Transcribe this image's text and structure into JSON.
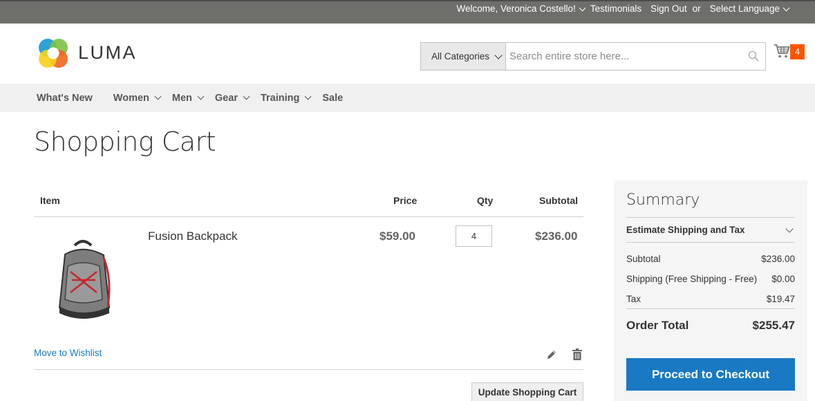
{
  "topbar": {
    "welcome": "Welcome, Veronica Costello!",
    "testimonials": "Testimonials",
    "sign_out": "Sign Out",
    "or": "or",
    "language": "Select Language"
  },
  "header": {
    "logo_text": "LUMA",
    "category_select": "All Categories",
    "search_placeholder": "Search entire store here...",
    "cart_count": "4"
  },
  "nav": {
    "items": [
      {
        "label": "What's New"
      },
      {
        "label": "Women"
      },
      {
        "label": "Men"
      },
      {
        "label": "Gear"
      },
      {
        "label": "Training"
      },
      {
        "label": "Sale"
      }
    ]
  },
  "page": {
    "title": "Shopping Cart"
  },
  "cart": {
    "headers": {
      "item": "Item",
      "price": "Price",
      "qty": "Qty",
      "subtotal": "Subtotal"
    },
    "items": [
      {
        "name": "Fusion Backpack",
        "price": "$59.00",
        "qty": "4",
        "subtotal": "$236.00"
      }
    ],
    "move_to_wishlist": "Move to Wishlist",
    "update_button": "Update Shopping Cart"
  },
  "summary": {
    "title": "Summary",
    "estimate": "Estimate Shipping and Tax",
    "rows": [
      {
        "label": "Subtotal",
        "value": "$236.00"
      },
      {
        "label": "Shipping (Free Shipping - Free)",
        "value": "$0.00"
      },
      {
        "label": "Tax",
        "value": "$19.47"
      }
    ],
    "order_total_label": "Order Total",
    "order_total_value": "$255.47",
    "checkout_button": "Proceed to Checkout"
  },
  "colors": {
    "topbar": "#6e6e6b",
    "nav_bg": "#f0f0f0",
    "accent_blue": "#1979c3",
    "cart_badge": "#ff5501"
  }
}
